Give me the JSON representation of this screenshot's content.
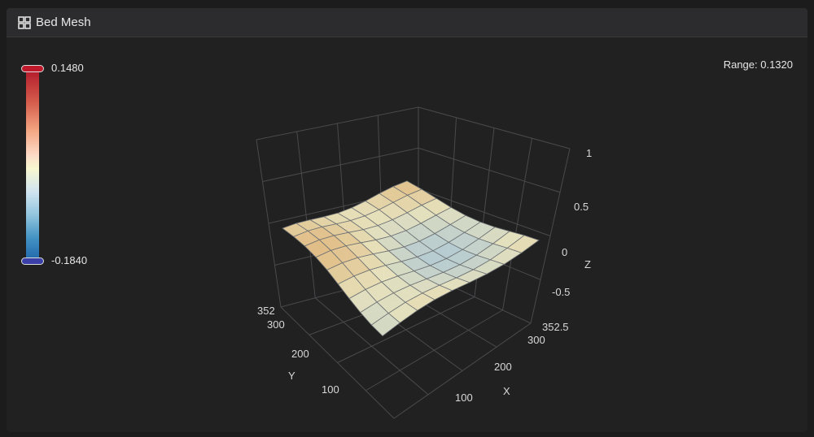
{
  "header": {
    "title": "Bed Mesh",
    "icon": "grid-icon"
  },
  "colorbar": {
    "max_label": "0.1480",
    "min_label": "-0.1840",
    "max_color": "#b2182b",
    "min_color": "#2166ac"
  },
  "range_text": "Range: 0.1320",
  "chart_data": {
    "type": "surface",
    "x_axis": {
      "label": "X",
      "ticks": [
        "100",
        "200",
        "300",
        "352.5"
      ]
    },
    "y_axis": {
      "label": "Y",
      "ticks": [
        "100",
        "200",
        "300",
        "352"
      ]
    },
    "z_axis": {
      "label": "Z",
      "ticks": [
        "1",
        "0.5",
        "0",
        "-0.5"
      ]
    },
    "zlim": [
      -0.5,
      1
    ],
    "grid": true
  }
}
